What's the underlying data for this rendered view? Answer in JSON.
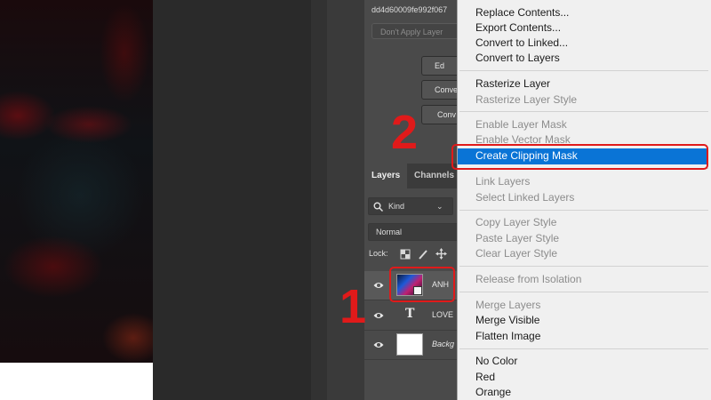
{
  "properties": {
    "id_text": "dd4d60009fe992f067",
    "dont_apply": "Don't Apply Layer",
    "btn1": "Ed",
    "btn2": "Conve",
    "btn3": "Conv"
  },
  "tabs": {
    "layers": "Layers",
    "channels": "Channels"
  },
  "filter": {
    "kind": "Kind",
    "blend_mode": "Normal",
    "lock_label": "Lock:"
  },
  "layers": [
    {
      "name": "ANH"
    },
    {
      "name": "LOVE"
    },
    {
      "name": "Backg"
    }
  ],
  "menu": {
    "items": [
      "Replace Contents...",
      "Export Contents...",
      "Convert to Linked...",
      "Convert to Layers",
      "Rasterize Layer",
      "Rasterize Layer Style",
      "Enable Layer Mask",
      "Enable Vector Mask",
      "Create Clipping Mask",
      "Link Layers",
      "Select Linked Layers",
      "Copy Layer Style",
      "Paste Layer Style",
      "Clear Layer Style",
      "Release from Isolation",
      "Merge Layers",
      "Merge Visible",
      "Flatten Image",
      "No Color",
      "Red",
      "Orange"
    ]
  },
  "annotations": {
    "step1": "1",
    "step2": "2"
  },
  "colors": {
    "highlight": "#0a74d6",
    "annotation_red": "#e01a1a"
  }
}
